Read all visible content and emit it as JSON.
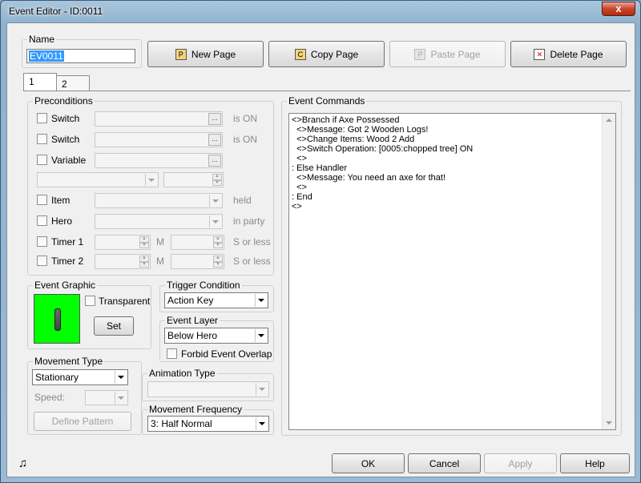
{
  "window": {
    "title": "Event Editor - ID:0011",
    "close_glyph": "x"
  },
  "name_group": {
    "label": "Name",
    "value": "EV0011"
  },
  "toolbar": {
    "new_page": "New Page",
    "copy_page": "Copy Page",
    "paste_page": "Paste Page",
    "delete_page": "Delete Page"
  },
  "tabs": [
    {
      "label": "1",
      "active": true
    },
    {
      "label": "2",
      "active": false
    }
  ],
  "preconditions": {
    "label": "Preconditions",
    "switch1": "Switch",
    "switch2": "Switch",
    "variable": "Variable",
    "item": "Item",
    "hero": "Hero",
    "timer1": "Timer 1",
    "timer2": "Timer 2",
    "is_on_1": "is ON",
    "is_on_2": "is ON",
    "held": "held",
    "in_party": "in party",
    "m1": "M",
    "m2": "M",
    "s_or_less_1": "S or less",
    "s_or_less_2": "S or less",
    "ellipsis": "..."
  },
  "event_graphic": {
    "label": "Event Graphic",
    "transparent": "Transparent",
    "set": "Set",
    "bg_color": "#00ff00"
  },
  "trigger": {
    "label": "Trigger Condition",
    "value": "Action Key"
  },
  "layer": {
    "label": "Event Layer",
    "value": "Below Hero",
    "forbid": "Forbid Event Overlap"
  },
  "movement": {
    "label": "Movement Type",
    "value": "Stationary",
    "speed": "Speed:",
    "define": "Define Pattern"
  },
  "animation": {
    "label": "Animation Type",
    "value": ""
  },
  "frequency": {
    "label": "Movement Frequency",
    "value": "3: Half Normal"
  },
  "commands": {
    "label": "Event Commands",
    "lines": [
      "<>Branch if Axe Possessed",
      "  <>Message: Got 2 Wooden Logs!",
      "  <>Change Items: Wood 2 Add",
      "  <>Switch Operation: [0005:chopped tree] ON",
      "  <>",
      ": Else Handler",
      "  <>Message: You need an axe for that!",
      "  <>",
      ": End",
      "<>"
    ]
  },
  "footer": {
    "ok": "OK",
    "cancel": "Cancel",
    "apply": "Apply",
    "help": "Help",
    "music_glyph": "♫"
  }
}
